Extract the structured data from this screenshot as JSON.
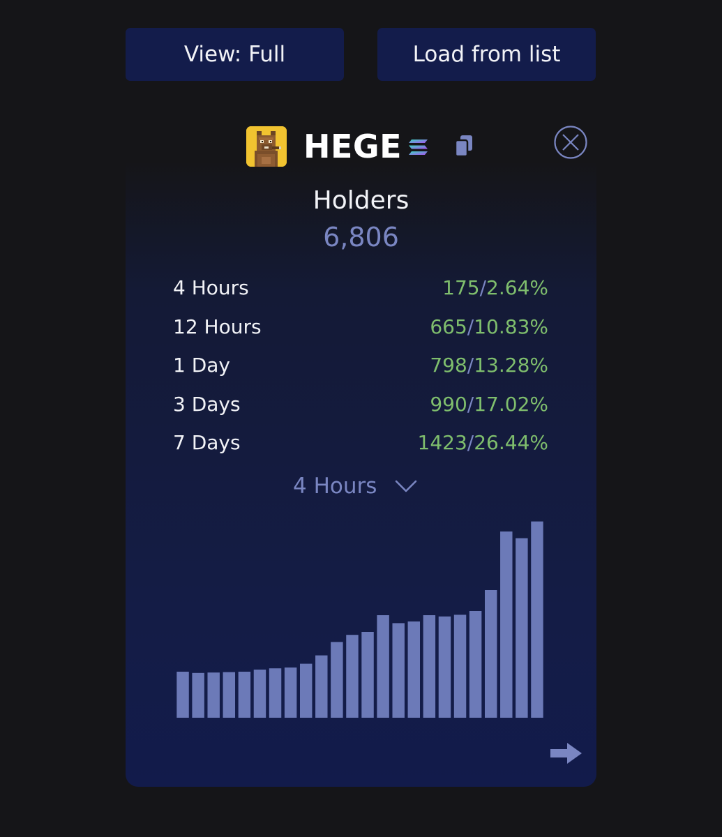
{
  "controls": {
    "view_label": "View: Full",
    "load_label": "Load from list"
  },
  "token": {
    "name": "HEGE",
    "avatar_icon": "pixel-creature-avatar-icon",
    "chain_icon": "solana-icon",
    "copy_icon": "copy-icon",
    "close_icon": "close-circle-icon",
    "avatar_bg": "#f1c330"
  },
  "holders": {
    "label": "Holders",
    "value": "6,806"
  },
  "stats": [
    {
      "period": "4 Hours",
      "count": "175",
      "percent": "2.64%"
    },
    {
      "period": "12 Hours",
      "count": "665",
      "percent": "10.83%"
    },
    {
      "period": "1 Day",
      "count": "798",
      "percent": "13.28%"
    },
    {
      "period": "3 Days",
      "count": "990",
      "percent": "17.02%"
    },
    {
      "period": "7 Days",
      "count": "1423",
      "percent": "26.44%"
    }
  ],
  "separator": "/",
  "selector": {
    "label": "4 Hours",
    "icon": "chevron-down-icon"
  },
  "chart_data": {
    "type": "bar",
    "values": [
      6420,
      6417,
      6418,
      6419,
      6420,
      6425,
      6428,
      6430,
      6439,
      6459,
      6491,
      6508,
      6515,
      6555,
      6536,
      6540,
      6555,
      6552,
      6556,
      6565,
      6615,
      6755,
      6739,
      6779
    ],
    "ylim": [
      6310,
      6800
    ],
    "grid": false
  },
  "footer": {
    "next_icon": "arrow-right-icon"
  },
  "colors": {
    "background": "#151518",
    "button": "#131c4b",
    "bar": "#6c7ab8",
    "positive": "#7fbe6d",
    "accent": "#7a86c2"
  }
}
